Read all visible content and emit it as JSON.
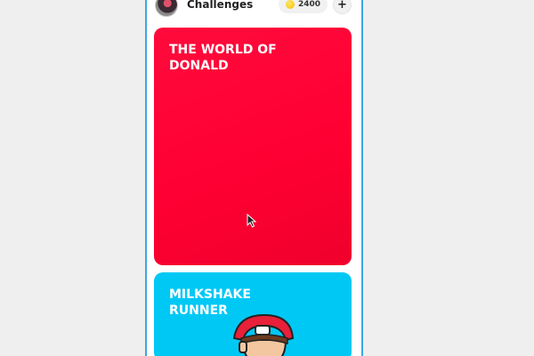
{
  "header": {
    "title": "Challenges",
    "coins": "2400",
    "add_label": "+"
  },
  "cards": [
    {
      "title": "THE WORLD OF DONALD",
      "color": "#ff0a3c"
    },
    {
      "title": "MILKSHAKE RUNNER",
      "color": "#00c8f5"
    }
  ],
  "colors": {
    "frame_border": "#3aa7e6",
    "coin": "#f5c400"
  },
  "icons": {
    "avatar": "avatar",
    "coin": "coin-icon",
    "add": "plus-icon",
    "cursor": "mouse-cursor-icon"
  }
}
